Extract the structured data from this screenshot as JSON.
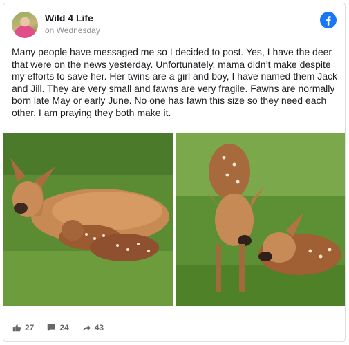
{
  "post": {
    "author": "Wild 4 Life",
    "time": "on Wednesday",
    "text": "Many people have messaged me so I decided to post. Yes, I have the deer that were on the news yesterday. Unfortunately, mama didn’t make despite my efforts to save her. Her twins are a girl and boy, I have named them Jack and Jill. They are very small and fawns are very fragile. Fawns are normally born late May or early June. No one has fawn this size so they need each other. I am praying they both make it."
  },
  "photos": {
    "left": {
      "icon": "doe-and-fawns-photo"
    },
    "right": {
      "icon": "two-fawns-photo"
    }
  },
  "actions": {
    "likes": "27",
    "comments": "24",
    "shares": "43"
  },
  "colors": {
    "facebook_blue": "#1877f2",
    "muted": "#65676b"
  }
}
